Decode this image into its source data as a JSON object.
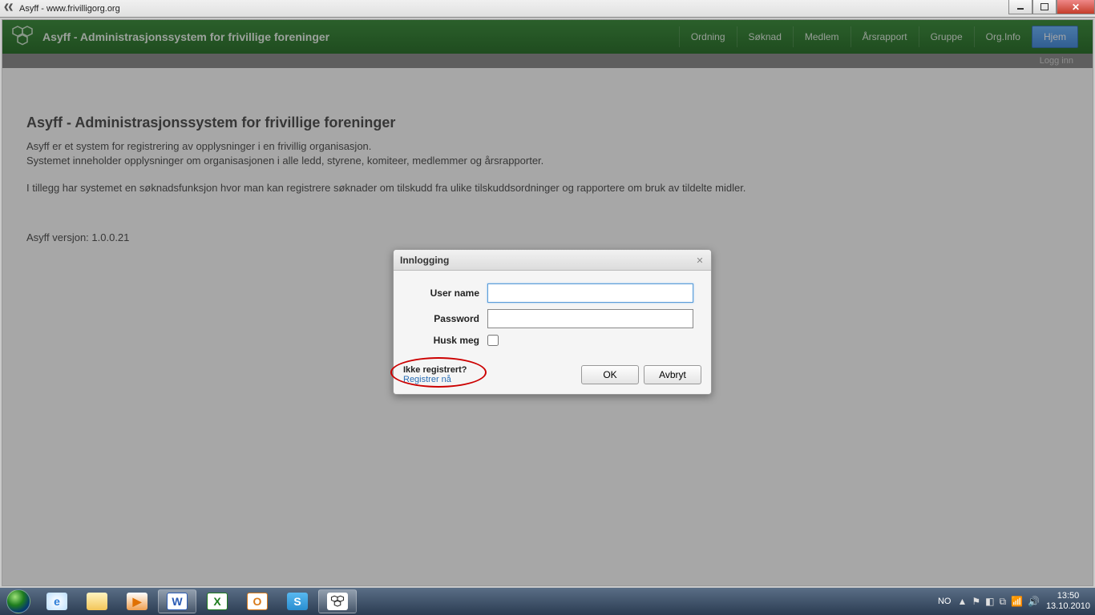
{
  "window": {
    "title": "Asyff - www.frivilligorg.org"
  },
  "header": {
    "brand": "Asyff - Administrasjonssystem for frivillige foreninger",
    "nav": [
      "Ordning",
      "Søknad",
      "Medlem",
      "Årsrapport",
      "Gruppe",
      "Org.Info",
      "Hjem"
    ],
    "active_nav_index": 6,
    "subbar_link": "Logg inn"
  },
  "page": {
    "heading": "Asyff - Administrasjonssystem for frivillige foreninger",
    "para1": "Asyff er et system for registrering av opplysninger i en frivillig organisasjon.",
    "para2": "Systemet inneholder opplysninger om organisasjonen i alle ledd, styrene, komiteer, medlemmer og årsrapporter.",
    "para3": "I tillegg har systemet en søknadsfunksjon hvor man kan registrere søknader om tilskudd fra ulike tilskuddsordninger og rapportere om bruk av tildelte midler.",
    "version": "Asyff versjon: 1.0.0.21"
  },
  "dialog": {
    "title": "Innlogging",
    "username_label": "User name",
    "password_label": "Password",
    "remember_label": "Husk meg",
    "not_registered": "Ikke registrert?",
    "register_link": "Registrer nå",
    "ok": "OK",
    "cancel": "Avbryt",
    "username_value": "",
    "password_value": ""
  },
  "taskbar": {
    "lang": "NO",
    "time": "13:50",
    "date": "13.10.2010"
  }
}
